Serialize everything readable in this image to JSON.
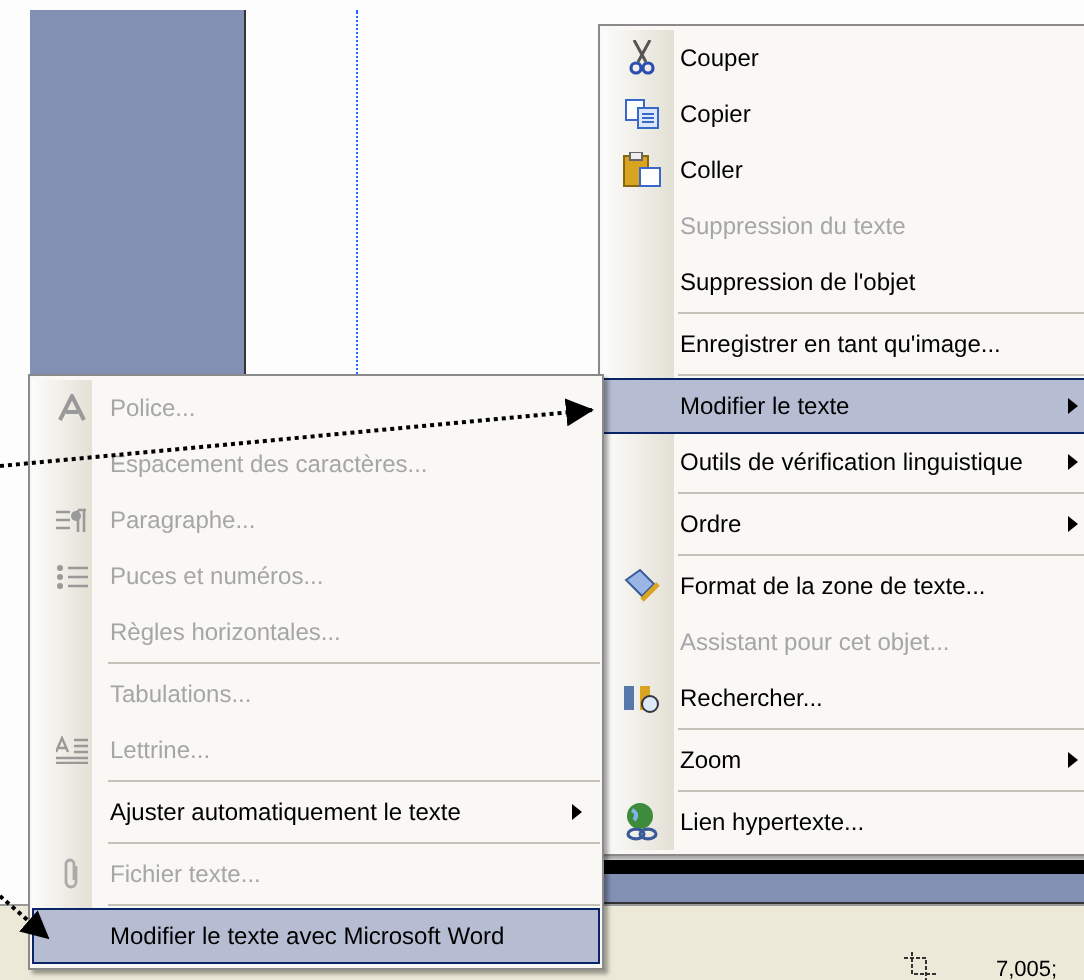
{
  "context_menu": {
    "items": [
      {
        "kind": "item",
        "label": "Couper",
        "disabled": false,
        "selected": false,
        "submenu": false
      },
      {
        "kind": "item",
        "label": "Copier",
        "disabled": false,
        "selected": false,
        "submenu": false
      },
      {
        "kind": "item",
        "label": "Coller",
        "disabled": false,
        "selected": false,
        "submenu": false
      },
      {
        "kind": "item",
        "label": "Suppression du texte",
        "disabled": true,
        "selected": false,
        "submenu": false
      },
      {
        "kind": "item",
        "label": "Suppression de l'objet",
        "disabled": false,
        "selected": false,
        "submenu": false
      },
      {
        "kind": "separator"
      },
      {
        "kind": "item",
        "label": "Enregistrer en tant qu'image...",
        "disabled": false,
        "selected": false,
        "submenu": false
      },
      {
        "kind": "separator"
      },
      {
        "kind": "item",
        "label": "Modifier le texte",
        "disabled": false,
        "selected": true,
        "submenu": true
      },
      {
        "kind": "item",
        "label": "Outils de vérification linguistique",
        "disabled": false,
        "selected": false,
        "submenu": true
      },
      {
        "kind": "separator"
      },
      {
        "kind": "item",
        "label": "Ordre",
        "disabled": false,
        "selected": false,
        "submenu": true
      },
      {
        "kind": "separator"
      },
      {
        "kind": "item",
        "label": "Format de la zone de texte...",
        "disabled": false,
        "selected": false,
        "submenu": false
      },
      {
        "kind": "item",
        "label": "Assistant pour cet objet...",
        "disabled": true,
        "selected": false,
        "submenu": false
      },
      {
        "kind": "item",
        "label": "Rechercher...",
        "disabled": false,
        "selected": false,
        "submenu": false
      },
      {
        "kind": "separator"
      },
      {
        "kind": "item",
        "label": "Zoom",
        "disabled": false,
        "selected": false,
        "submenu": true
      },
      {
        "kind": "separator"
      },
      {
        "kind": "item",
        "label": "Lien hypertexte...",
        "disabled": false,
        "selected": false,
        "submenu": false
      }
    ]
  },
  "submenu": {
    "items": [
      {
        "kind": "item",
        "label": "Police...",
        "disabled": true,
        "selected": false,
        "submenu": false
      },
      {
        "kind": "item",
        "label": "Espacement des caractères...",
        "disabled": true,
        "selected": false,
        "submenu": false
      },
      {
        "kind": "item",
        "label": "Paragraphe...",
        "disabled": true,
        "selected": false,
        "submenu": false
      },
      {
        "kind": "item",
        "label": "Puces et numéros...",
        "disabled": true,
        "selected": false,
        "submenu": false
      },
      {
        "kind": "item",
        "label": "Règles horizontales...",
        "disabled": true,
        "selected": false,
        "submenu": false
      },
      {
        "kind": "separator"
      },
      {
        "kind": "item",
        "label": "Tabulations...",
        "disabled": true,
        "selected": false,
        "submenu": false
      },
      {
        "kind": "item",
        "label": "Lettrine...",
        "disabled": true,
        "selected": false,
        "submenu": false
      },
      {
        "kind": "separator"
      },
      {
        "kind": "item",
        "label": "Ajuster automatiquement le texte",
        "disabled": false,
        "selected": false,
        "submenu": true
      },
      {
        "kind": "separator"
      },
      {
        "kind": "item",
        "label": "Fichier texte...",
        "disabled": true,
        "selected": false,
        "submenu": false
      },
      {
        "kind": "separator"
      },
      {
        "kind": "item",
        "label": "Modifier le texte avec Microsoft Word",
        "disabled": false,
        "selected": true,
        "submenu": false
      }
    ]
  },
  "status_bar": {
    "position": "7,005;"
  }
}
